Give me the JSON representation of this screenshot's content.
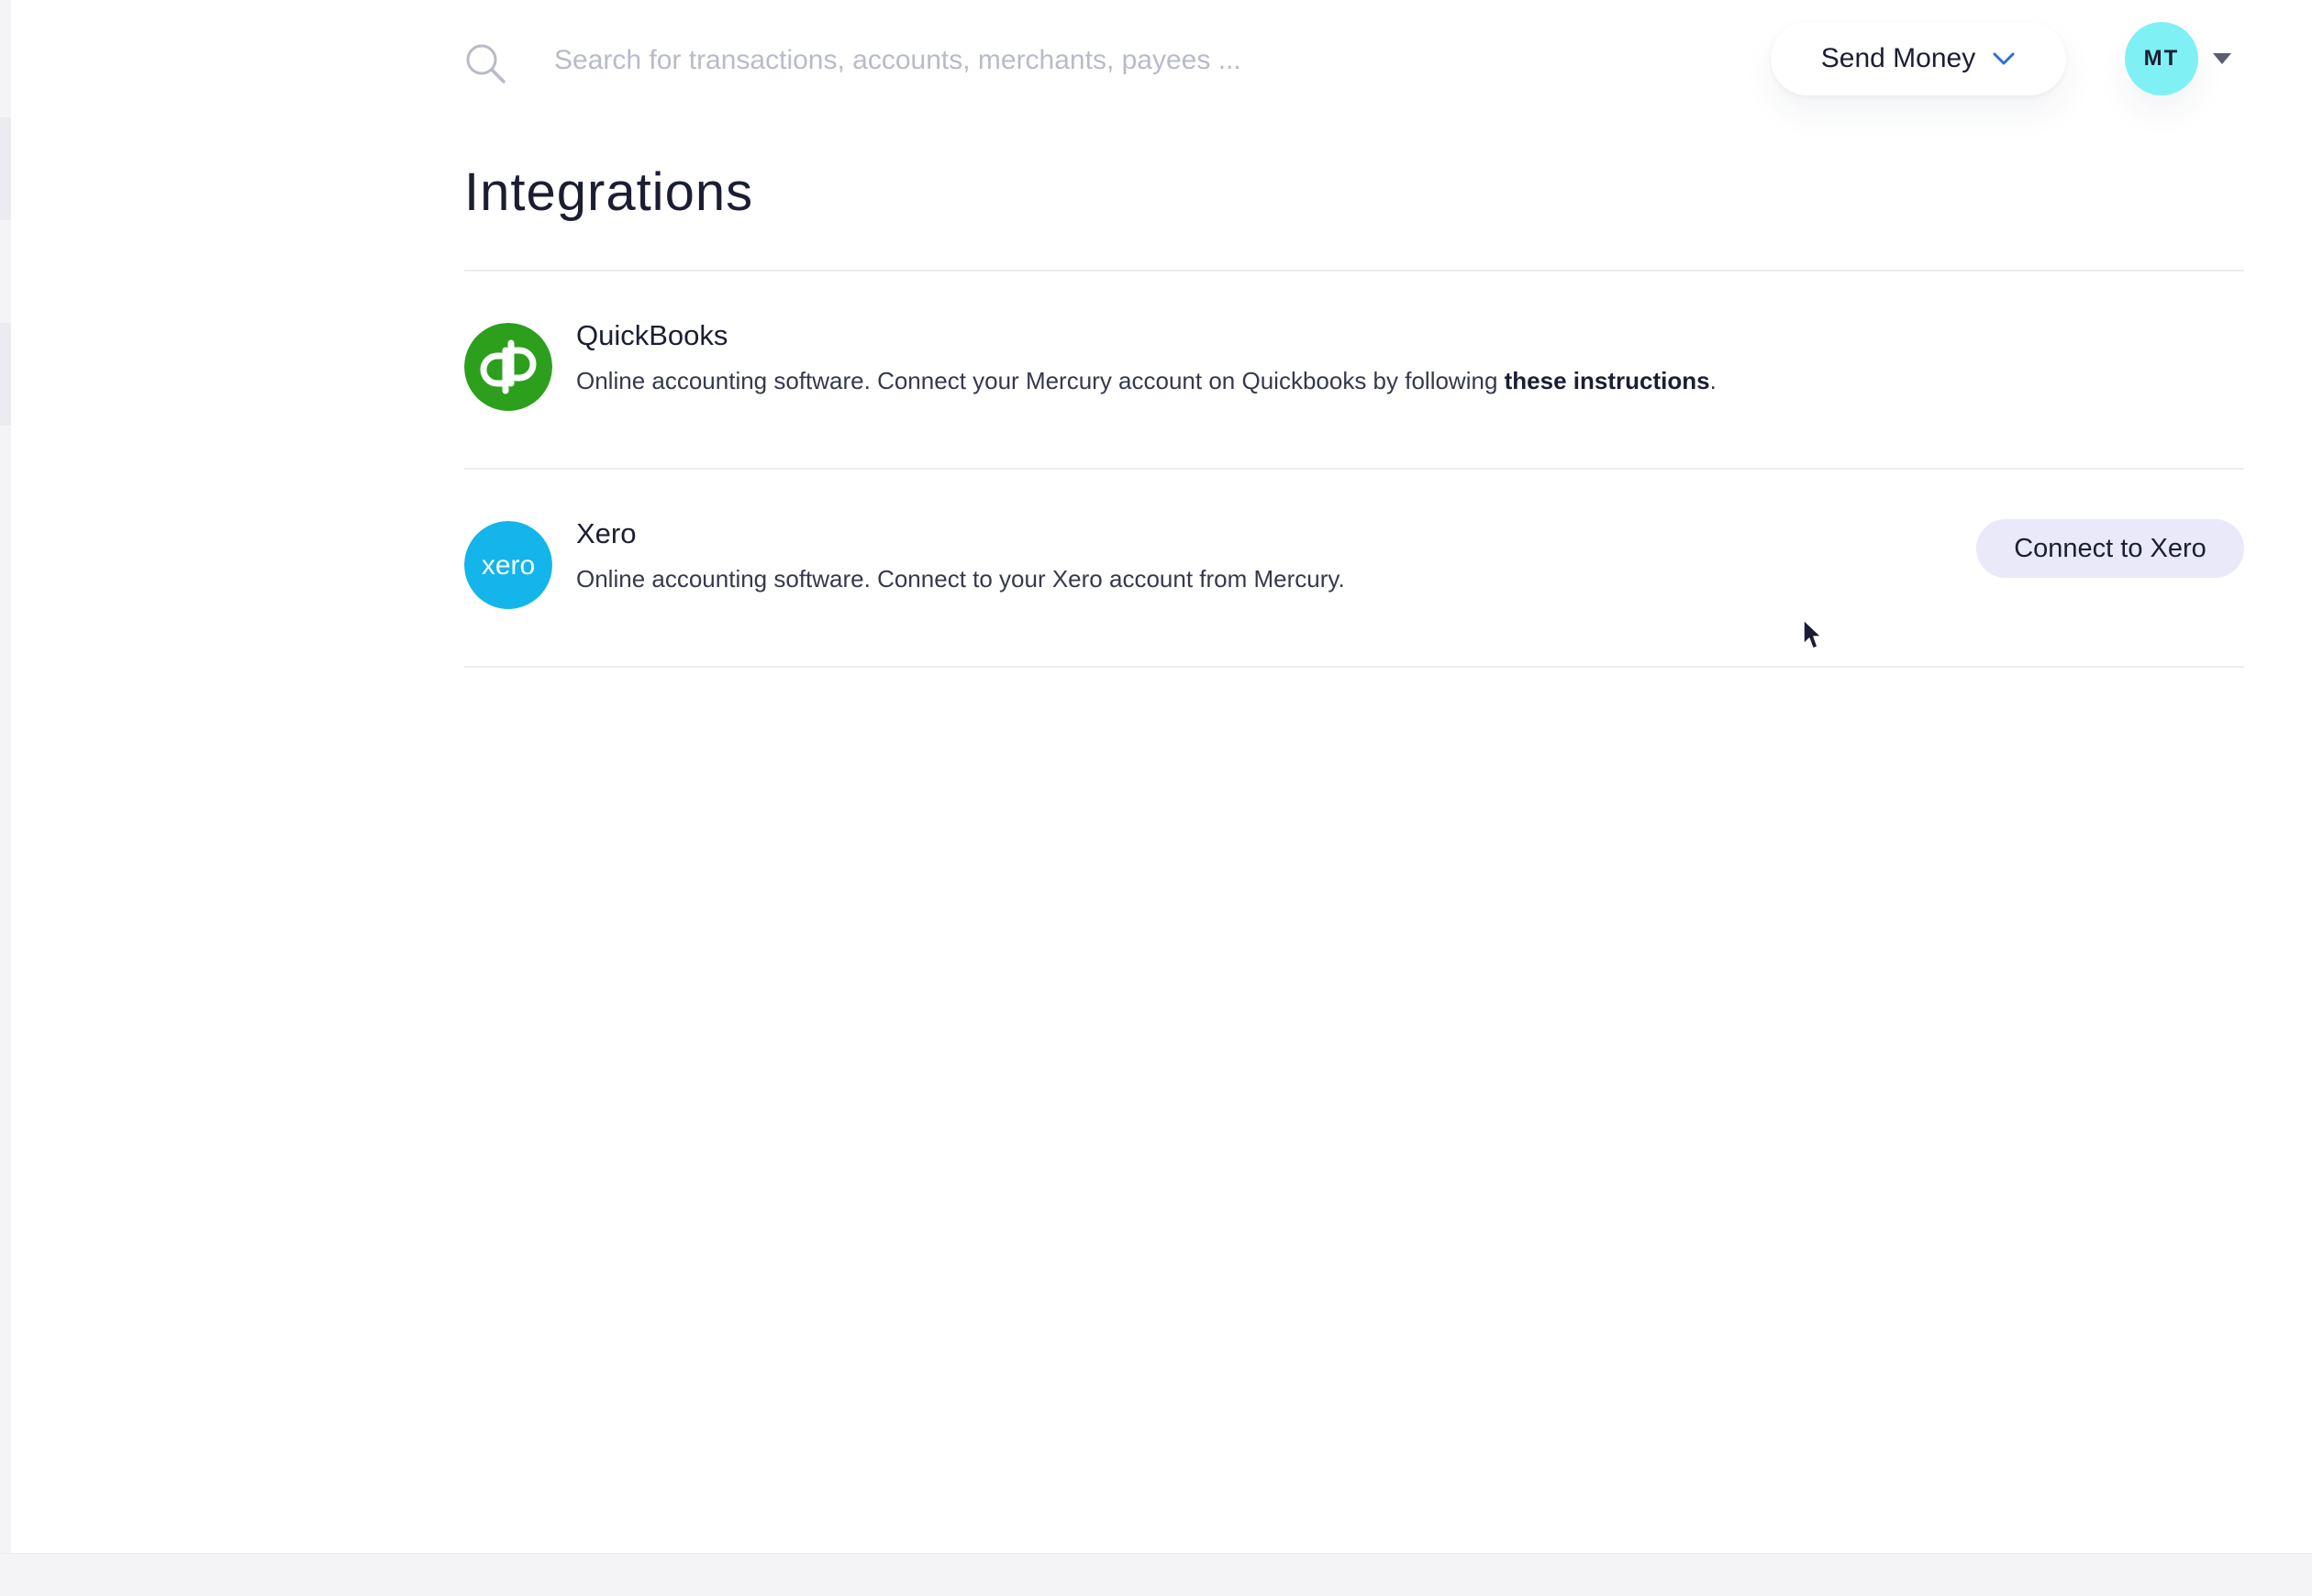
{
  "search": {
    "placeholder": "Search for transactions, accounts, merchants, payees ..."
  },
  "header": {
    "send_money_label": "Send Money",
    "avatar_initials": "MT"
  },
  "page": {
    "title": "Integrations"
  },
  "integrations": [
    {
      "name": "QuickBooks",
      "description_prefix": "Online accounting software. Connect your Mercury account on Quickbooks by following ",
      "link_label": "these instructions",
      "description_suffix": ".",
      "logo_icon": "quickbooks-logo",
      "logo_color": "#2ca01c"
    },
    {
      "name": "Xero",
      "description": "Online accounting software. Connect to your Xero account from Mercury.",
      "button_label": "Connect to Xero",
      "logo_icon": "xero-logo",
      "logo_text": "xero",
      "logo_color": "#13b5ea"
    }
  ],
  "colors": {
    "accent_button_bg": "#e9e9f9",
    "avatar_bg": "#7ff1f4",
    "text_primary": "#1b1e33",
    "send_money_chevron": "#2a6fd6"
  }
}
